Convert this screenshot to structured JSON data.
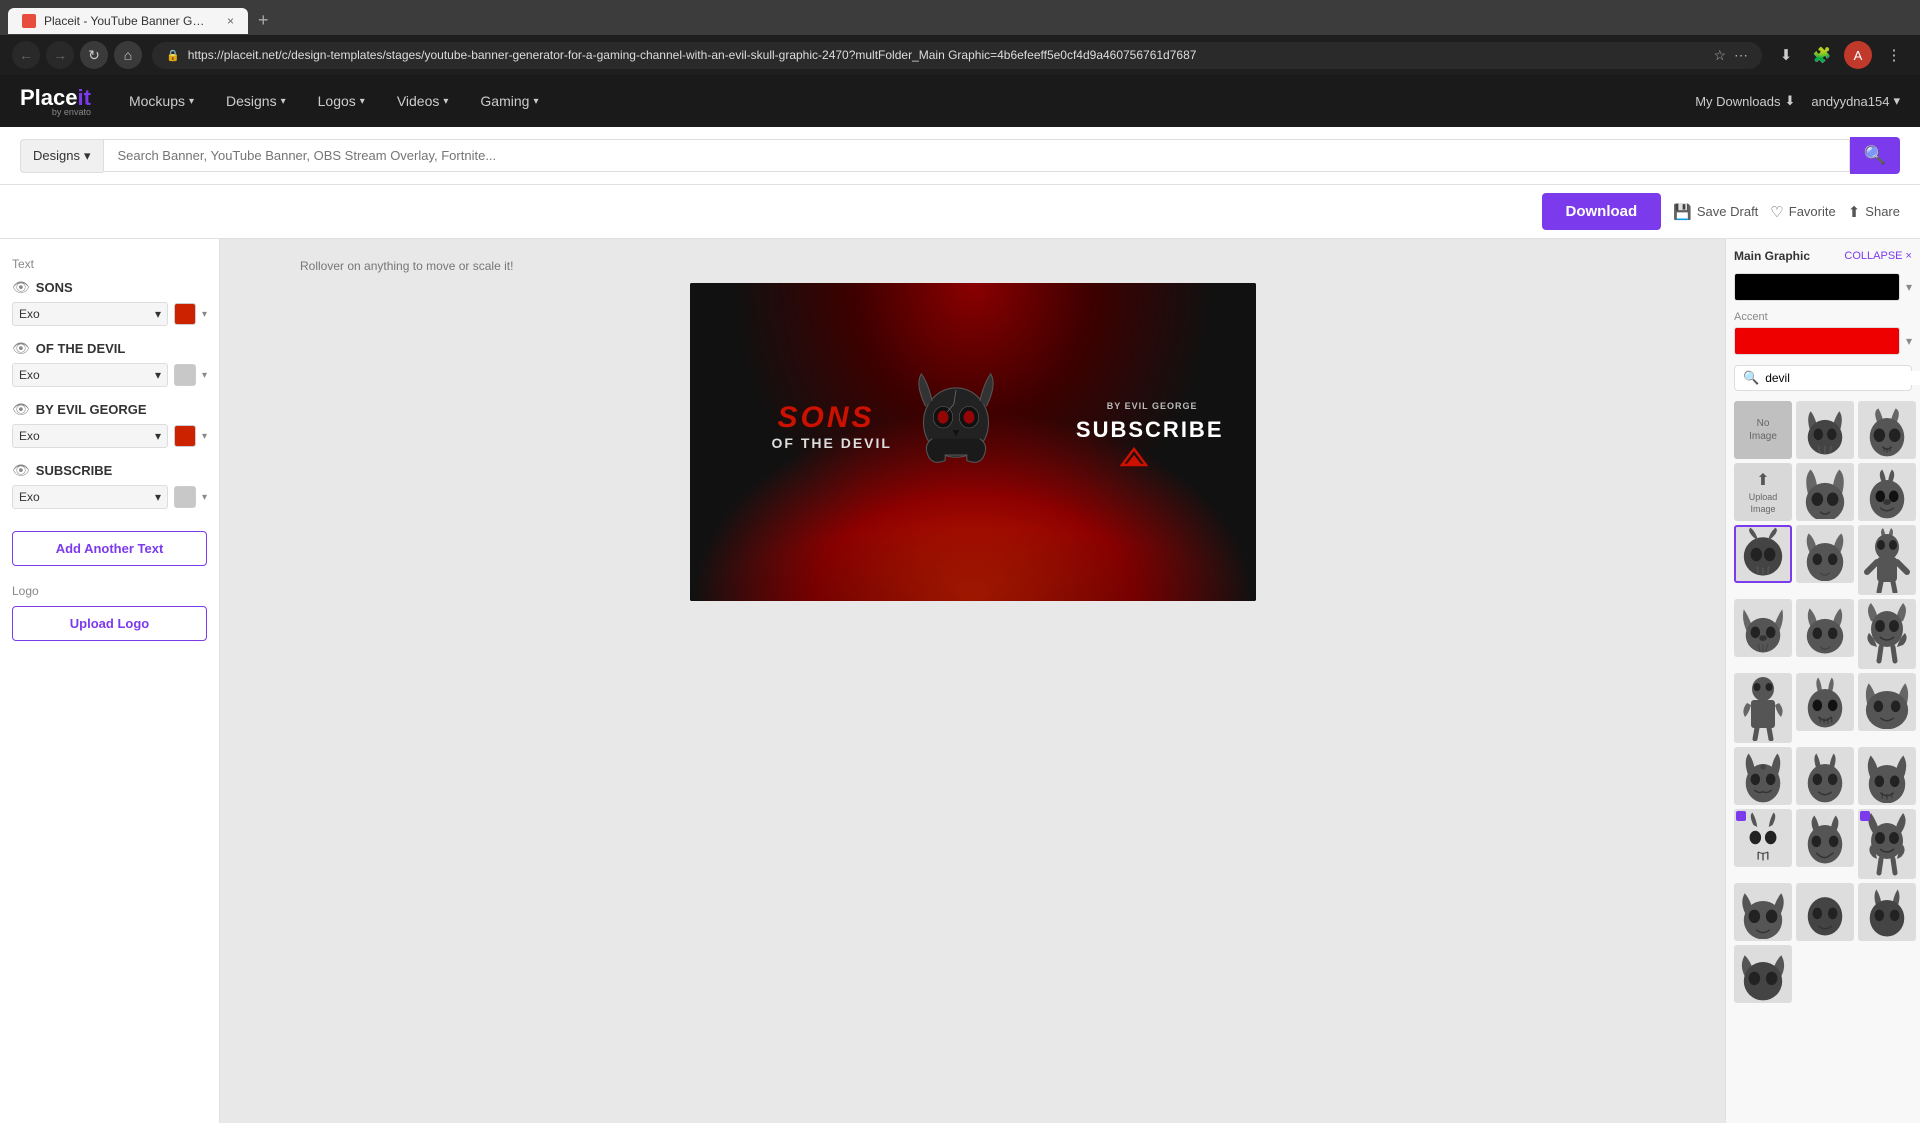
{
  "browser": {
    "tab_title": "Placeit - YouTube Banner Gene...",
    "tab_close": "×",
    "new_tab": "+",
    "address": "https://placeit.net/c/design-templates/stages/youtube-banner-generator-for-a-gaming-channel-with-an-evil-skull-graphic-2470?multFolder_Main Graphic=4b6efeeff5e0cf4d9a460756761d7687",
    "nav": {
      "back_disabled": true,
      "forward_disabled": true
    }
  },
  "header": {
    "logo_place": "Place",
    "logo_it": "it",
    "logo_sub": "by envato",
    "nav_items": [
      {
        "label": "Mockups",
        "has_dropdown": true
      },
      {
        "label": "Designs",
        "has_dropdown": true
      },
      {
        "label": "Logos",
        "has_dropdown": true
      },
      {
        "label": "Videos",
        "has_dropdown": true
      },
      {
        "label": "Gaming",
        "has_dropdown": true
      }
    ],
    "my_downloads": "My Downloads",
    "user": "andyydna154"
  },
  "search_bar": {
    "type_label": "Designs",
    "placeholder": "Search Banner, YouTube Banner, OBS Stream Overlay, Fortnite...",
    "search_icon": "🔍"
  },
  "toolbar": {
    "download_label": "Download",
    "save_draft_label": "Save Draft",
    "favorite_label": "Favorite",
    "share_label": "Share"
  },
  "left_panel": {
    "section_label": "Text",
    "text_items": [
      {
        "id": "sons",
        "value": "SONS",
        "font": "Exo",
        "color": "#cc2200",
        "visible": true
      },
      {
        "id": "of-the-devil",
        "value": "OF THE DEVIL",
        "font": "Exo",
        "color": "#c0c0c0",
        "visible": true
      },
      {
        "id": "by-evil-george",
        "value": "BY EVIL GEORGE",
        "font": "Exo",
        "color": "#cc2200",
        "visible": true
      },
      {
        "id": "subscribe",
        "value": "SUBSCRIBE",
        "font": "Exo",
        "color": "#c0c0c0",
        "visible": true
      }
    ],
    "add_text_label": "Add Another Text",
    "logo_section_label": "Logo",
    "upload_logo_label": "Upload Logo"
  },
  "canvas": {
    "hint": "Rollover on anything to move or scale it!",
    "banner": {
      "text_sons": "SONS",
      "text_devil": "OF THE DEVIL",
      "text_byevil": "BY EVIL GEORGE",
      "text_subscribe": "SUBSCRIBE"
    }
  },
  "right_panel": {
    "title": "Main Graphic",
    "collapse_label": "COLLAPSE ×",
    "main_color_label": "",
    "accent_label": "Accent",
    "search_placeholder": "devil",
    "graphics": [
      {
        "id": "no-image",
        "type": "no-image",
        "label": "No Image"
      },
      {
        "id": "g1",
        "type": "skull-horns-1",
        "selected": false
      },
      {
        "id": "g2",
        "type": "devil-face-1",
        "selected": false
      },
      {
        "id": "upload",
        "type": "upload",
        "label": "Upload Image"
      },
      {
        "id": "g3",
        "type": "skull-horns-2",
        "selected": false
      },
      {
        "id": "g4",
        "type": "devil-face-2",
        "selected": false
      },
      {
        "id": "g5",
        "type": "skull-ornate",
        "selected": true
      },
      {
        "id": "g6",
        "type": "skull-horns-3",
        "selected": false
      },
      {
        "id": "g7",
        "type": "devil-figure",
        "selected": false
      },
      {
        "id": "g8",
        "type": "goat-skull",
        "selected": false
      },
      {
        "id": "g9",
        "type": "skull-horns-4",
        "selected": false
      },
      {
        "id": "g10",
        "type": "devil-dragon",
        "selected": false
      },
      {
        "id": "g11",
        "type": "knight-body",
        "selected": false
      },
      {
        "id": "g12",
        "type": "devil-face-3",
        "selected": false
      },
      {
        "id": "g13",
        "type": "beast-head",
        "selected": false
      },
      {
        "id": "g14",
        "type": "devil-ornate-1",
        "selected": false
      },
      {
        "id": "g15",
        "type": "devil-ornate-2",
        "selected": false
      },
      {
        "id": "g16",
        "type": "devil-ornate-3",
        "selected": false
      },
      {
        "id": "g17",
        "type": "premium-skull-1",
        "premium": true,
        "selected": false
      },
      {
        "id": "g18",
        "type": "devil-face-4",
        "selected": false
      },
      {
        "id": "g19",
        "type": "premium-dragon",
        "premium": true,
        "selected": false
      },
      {
        "id": "g20",
        "type": "horned-beast",
        "selected": false
      }
    ]
  }
}
